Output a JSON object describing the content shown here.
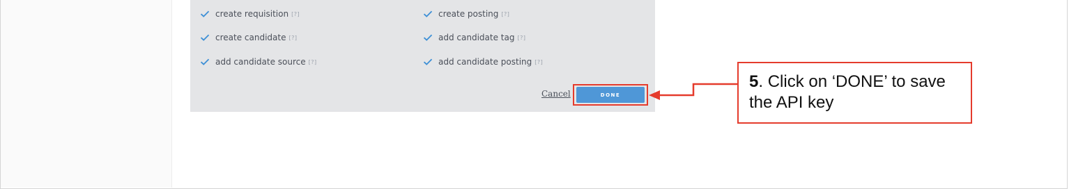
{
  "permissions": {
    "help_marker": "[?]",
    "items": [
      {
        "label": "create requisition",
        "checked": true
      },
      {
        "label": "create posting",
        "checked": true
      },
      {
        "label": "create candidate",
        "checked": true
      },
      {
        "label": "add candidate tag",
        "checked": true
      },
      {
        "label": "add candidate source",
        "checked": true
      },
      {
        "label": "add candidate posting",
        "checked": true
      }
    ]
  },
  "actions": {
    "cancel_label": "Cancel",
    "done_label": "DONE"
  },
  "callout": {
    "step_number": "5",
    "text": ". Click on ‘DONE’ to save the API key"
  },
  "colors": {
    "accent_blue": "#4f97d7",
    "annotation_red": "#e53b2c",
    "panel_gray": "#e4e5e7",
    "check_blue": "#3d8fd6"
  },
  "icons": {
    "checkbox": "check-icon",
    "callout_pointer": "arrow-left-icon"
  }
}
